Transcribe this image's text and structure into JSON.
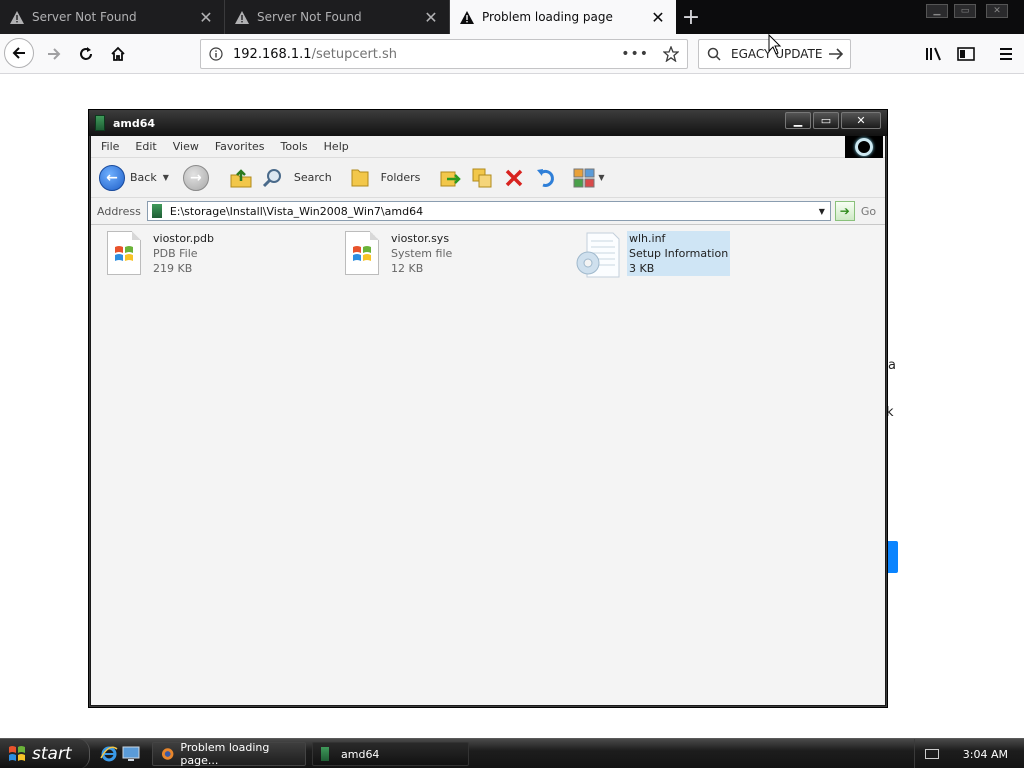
{
  "browser": {
    "tabs": [
      {
        "label": "Server Not Found",
        "active": false
      },
      {
        "label": "Server Not Found",
        "active": false
      },
      {
        "label": "Problem loading page",
        "active": true
      }
    ],
    "url_host": "192.168.1.1",
    "url_path": "/setupcert.sh",
    "search_text": "EGACY UPDATE",
    "bg_fragments": [
      "a",
      "k"
    ]
  },
  "explorer": {
    "title": "amd64",
    "menu": [
      "File",
      "Edit",
      "View",
      "Favorites",
      "Tools",
      "Help"
    ],
    "toolbar": {
      "back_label": "Back",
      "search_label": "Search",
      "folders_label": "Folders"
    },
    "address_label": "Address",
    "address_path": "E:\\storage\\Install\\Vista_Win2008_Win7\\amd64",
    "go_label": "Go",
    "files": [
      {
        "name": "viostor.pdb",
        "type": "PDB File",
        "size": "219 KB",
        "icon": "windows-file-icon"
      },
      {
        "name": "viostor.sys",
        "type": "System file",
        "size": "12 KB",
        "icon": "windows-file-icon"
      },
      {
        "name": "wlh.inf",
        "type": "Setup Information",
        "size": "3 KB",
        "icon": "setup-info-icon",
        "selected": true
      }
    ]
  },
  "taskbar": {
    "start_label": "start",
    "tasks": [
      {
        "label": "Problem loading page...",
        "active": false
      },
      {
        "label": "amd64",
        "active": true
      }
    ],
    "clock": "3:04 AM"
  },
  "colors": {
    "accent_blue": "#0a84ff",
    "selection": "#cfe5f5",
    "title_bar": "#1a1a1a"
  }
}
